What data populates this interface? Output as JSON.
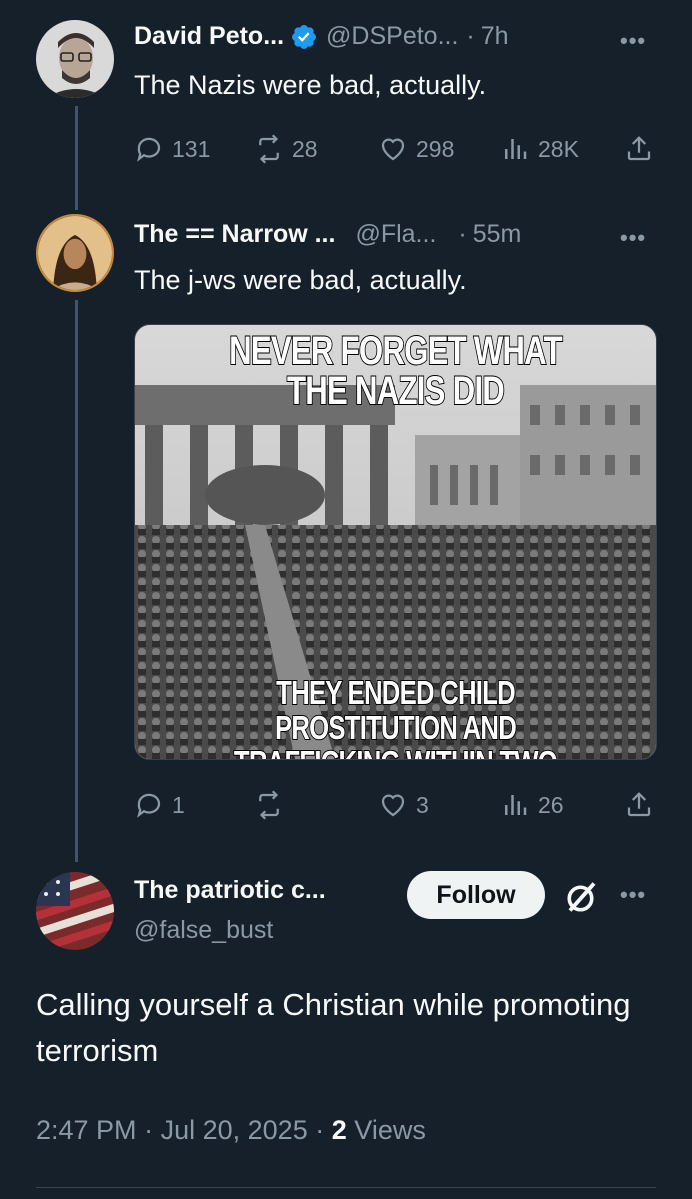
{
  "tweets": [
    {
      "name": "David Peto...",
      "handle": "@DSPeto...",
      "dot": "·",
      "time": "7h",
      "text": "The Nazis were bad, actually.",
      "verified": true,
      "replies": "131",
      "reposts": "28",
      "likes": "298",
      "views": "28K"
    },
    {
      "name": "The == Narrow ...",
      "handle": "@Fla...",
      "dot": "·",
      "time": "55m",
      "text": "The j-ws were bad, actually.",
      "replies": "1",
      "reposts": "",
      "likes": "3",
      "views": "26",
      "image": {
        "top_text_line1": "NEVER FORGET WHAT",
        "top_text_line2": "THE NAZIS DID",
        "bottom_text_line1": "THEY ENDED CHILD PROSTITUTION AND",
        "bottom_text_line2": "TRAFFICKING WITHIN TWO WEEKS"
      }
    }
  ],
  "main_tweet": {
    "name": "The patriotic c...",
    "handle": "@false_bust",
    "follow_label": "Follow",
    "text": "Calling yourself a Christian while promoting terrorism",
    "time": "2:47 PM",
    "separator": "·",
    "date": "Jul 20, 2025",
    "views_count": "2",
    "views_label": "Views"
  },
  "more_label": "•••",
  "colors": {
    "background": "#15202b",
    "text": "#f7f9f9",
    "secondary": "#8b98a5",
    "verified": "#1d9bf0",
    "thread_line": "#42536a"
  }
}
